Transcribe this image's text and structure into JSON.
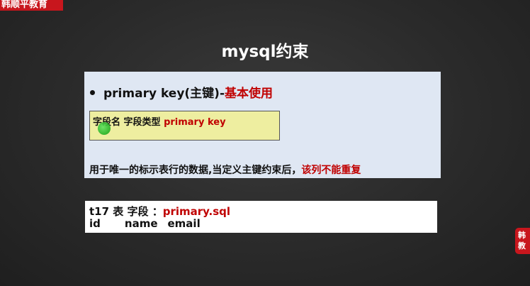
{
  "brand": {
    "logo_text": "韩顺平教育",
    "side_badge_lines": [
      "韩",
      "教"
    ]
  },
  "slide": {
    "title": "mysql约束",
    "bullet": {
      "prefix": "primary key(主键)-",
      "highlight": "基本使用"
    },
    "syntax": {
      "text_plain": "字段名 字段类型 ",
      "text_red": "primary key"
    },
    "description": {
      "text_plain": "用于唯一的标示表行的数据,当定义主键约束后，",
      "text_red": "该列不能重复"
    },
    "example": {
      "line1_plain": "t17 表 字段 ：",
      "line1_red": "primary.sql",
      "columns": [
        "id",
        "name",
        "email"
      ]
    }
  },
  "colors": {
    "accent_red": "#c00000",
    "brand_red": "#c8161d",
    "panel_blue": "#dfe7f3",
    "syntax_yellow": "#eeeea0"
  }
}
